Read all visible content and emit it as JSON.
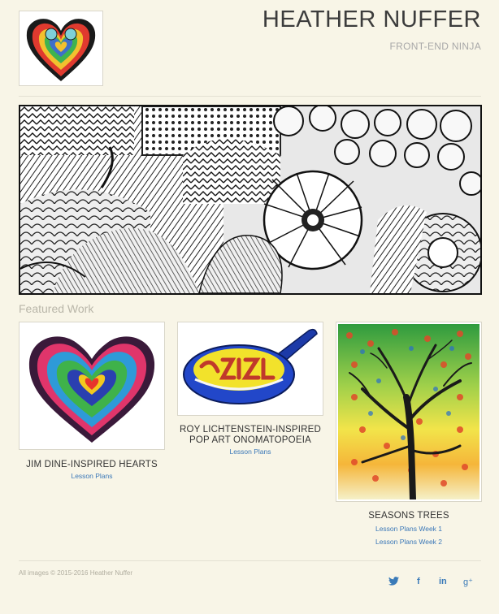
{
  "header": {
    "title": "HEATHER NUFFER",
    "tagline": "FRONT-END NINJA"
  },
  "featured": {
    "heading": "Featured Work",
    "items": [
      {
        "title": "JIM DINE-INSPIRED HEARTS",
        "links": [
          "Lesson Plans"
        ]
      },
      {
        "title_line1": "ROY LICHTENSTEIN-INSPIRED",
        "title_line2": "POP ART ONOMATOPOEIA",
        "links": [
          "Lesson Plans"
        ]
      },
      {
        "title": "SEASONS TREES",
        "links": [
          "Lesson Plans Week 1",
          "Lesson Plans Week 2"
        ]
      }
    ]
  },
  "footer": {
    "copyright": "All images © 2015-2016 Heather Nuffer",
    "social": [
      {
        "icon": "twitter-icon",
        "glyph": "🐦"
      },
      {
        "icon": "facebook-icon",
        "glyph": "f"
      },
      {
        "icon": "linkedin-icon",
        "glyph": "in"
      },
      {
        "icon": "google-plus-icon",
        "glyph": "g⁺"
      }
    ]
  },
  "colors": {
    "background": "#f8f5e7",
    "link": "#3b78b8",
    "title": "#3c3c3c"
  }
}
